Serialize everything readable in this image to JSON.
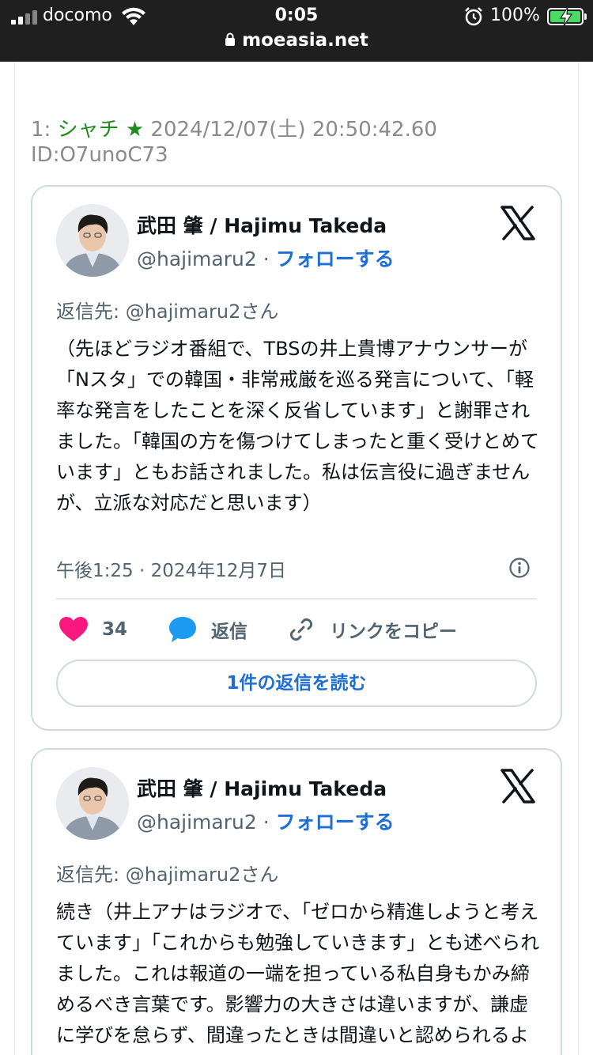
{
  "status_bar": {
    "carrier": "docomo",
    "time": "0:05",
    "battery_percent": "100%",
    "battery_level": 1.0,
    "url": "moeasia.net"
  },
  "post": {
    "number": "1:",
    "name": "シャチ ★",
    "meta": "2024/12/07(土) 20:50:42.60 ID:O7unoC73"
  },
  "tweets": [
    {
      "author": "武田 肇 / Hajimu Takeda",
      "handle": "@hajimaru2",
      "separator": "·",
      "follow_label": "フォローする",
      "reply_to": "返信先: @hajimaru2さん",
      "text": "（先ほどラジオ番組で、TBSの井上貴博アナウンサーが「Nスタ」での韓国・非常戒厳を巡る発言について、「軽率な発言をしたことを深く反省しています」と謝罪されました。「韓国の方を傷つけてしまったと重く受けとめています」ともお話されました。私は伝言役に過ぎませんが、立派な対応だと思います）",
      "timestamp": "午後1:25 · 2024年12月7日",
      "likes": "34",
      "reply_label": "返信",
      "copy_link_label": "リンクをコピー",
      "read_replies_label": "1件の返信を読む"
    },
    {
      "author": "武田 肇 / Hajimu Takeda",
      "handle": "@hajimaru2",
      "separator": "·",
      "follow_label": "フォローする",
      "reply_to": "返信先: @hajimaru2さん",
      "text": "続き（井上アナはラジオで、「ゼロから精進しようと考えています」「これからも勉強していきます」とも述べられました。これは報道の一端を担っている私自身もかみ締めるべき言葉です。影響力の大きさは違いますが、謙虚に学びを怠らず、間違ったときは間違いと認められるように心がけたいと思います"
    }
  ],
  "colors": {
    "link_blue": "#1d6fd6",
    "name_green": "#228b22",
    "like_pink": "#f91880",
    "reply_blue": "#1d9bf0"
  }
}
